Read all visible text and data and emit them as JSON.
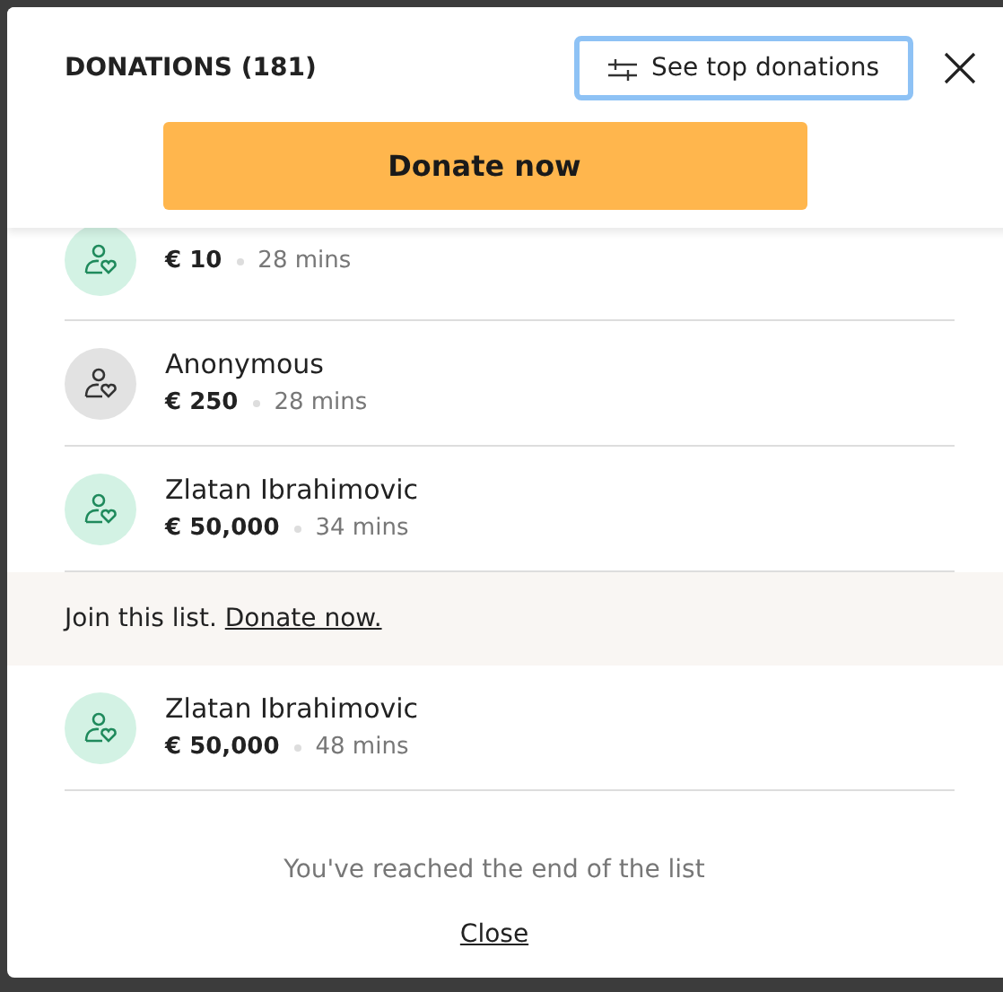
{
  "header": {
    "title": "DONATIONS (181)",
    "filter_button": {
      "label": "See top donations",
      "focused": true
    }
  },
  "donate_button": "Donate now",
  "donations": [
    {
      "kind": "named",
      "amount": "€ 10",
      "time": "28 mins"
    },
    {
      "kind": "anonymous",
      "name": "Anonymous",
      "amount": "€ 250",
      "time": "28 mins"
    },
    {
      "kind": "named",
      "name": "Zlatan Ibrahimovic",
      "amount": "€ 50,000",
      "time": "34 mins"
    }
  ],
  "join_banner": {
    "text": "Join this list.",
    "link": "Donate now."
  },
  "more_donations": [
    {
      "kind": "named",
      "name": "Zlatan Ibrahimovic",
      "amount": "€ 50,000",
      "time": "48 mins"
    }
  ],
  "end_message": "You've reached the end of the list",
  "close_link": "Close"
}
